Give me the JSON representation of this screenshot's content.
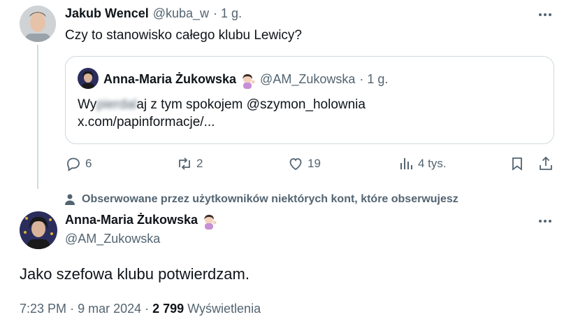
{
  "tweet1": {
    "author_name": "Jakub Wencel",
    "author_handle": "@kuba_w",
    "time": "· 1 g.",
    "text": "Czy to stanowisko całego klubu Lewicy?",
    "quoted": {
      "author_name": "Anna-Maria Żukowska",
      "author_handle": "@AM_Zukowska",
      "time": "· 1 g.",
      "text_prefix": "Wy",
      "text_blurred": "pierdal",
      "text_suffix": "aj z tym spokojem @szymon_holownia",
      "link": "x.com/papinformacje/..."
    },
    "actions": {
      "replies": "6",
      "reposts": "2",
      "likes": "19",
      "views": "4 tys."
    }
  },
  "social_context": "Obserwowane przez użytkowników niektórych kont, które obserwujesz",
  "tweet2": {
    "author_name": "Anna-Maria Żukowska",
    "author_handle": "@AM_Zukowska",
    "text": "Jako szefowa klubu potwierdzam.",
    "time": "7:23 PM",
    "date": "9 mar 2024",
    "views_count": "2 799",
    "views_label": "Wyświetlenia"
  },
  "icons": {
    "reply": "reply-icon",
    "repost": "repost-icon",
    "like": "heart-icon",
    "views": "analytics-icon",
    "bookmark": "bookmark-icon",
    "share": "share-icon",
    "more": "more-icon",
    "person": "person-icon"
  },
  "colors": {
    "text_primary": "#0f1419",
    "text_secondary": "#536471",
    "border": "#cfd9de"
  }
}
